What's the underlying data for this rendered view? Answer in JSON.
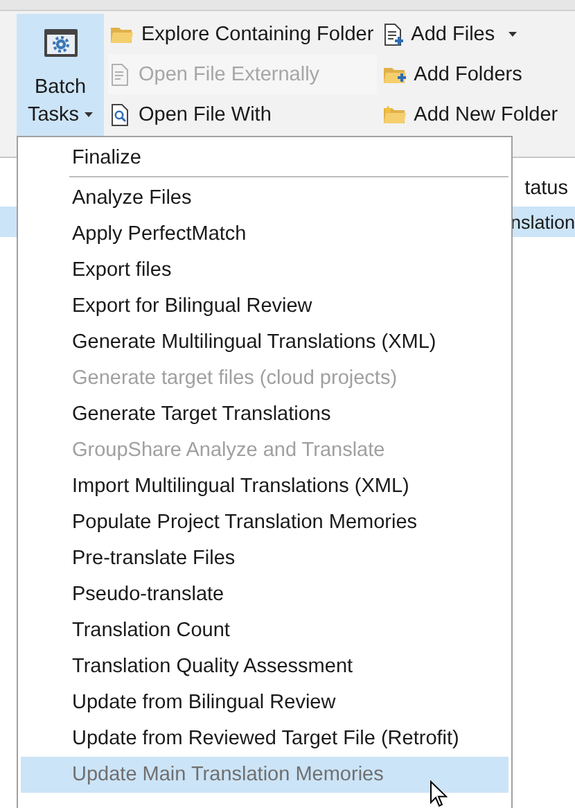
{
  "ribbon": {
    "batch_button": {
      "label": "Batch Tasks",
      "dropdown": true,
      "selected": true
    },
    "columns": [
      [
        {
          "label": "Explore Containing Folder",
          "disabled": false,
          "dropdown": false
        },
        {
          "label": "Open File Externally",
          "disabled": true,
          "dropdown": false
        },
        {
          "label": "Open File With",
          "disabled": false,
          "dropdown": false
        }
      ],
      [
        {
          "label": "Add Files",
          "disabled": false,
          "dropdown": true
        },
        {
          "label": "Add Folders",
          "disabled": false,
          "dropdown": false
        },
        {
          "label": "Add New Folder",
          "disabled": false,
          "dropdown": false
        }
      ]
    ]
  },
  "table": {
    "header": "tatus",
    "row": {
      "cell": "nslation",
      "selected": true
    }
  },
  "menu": {
    "groups": [
      [
        {
          "label": "Finalize",
          "disabled": false,
          "selected": false
        }
      ],
      [
        {
          "label": "Analyze Files",
          "disabled": false,
          "selected": false
        },
        {
          "label": "Apply PerfectMatch",
          "disabled": false,
          "selected": false
        },
        {
          "label": "Export files",
          "disabled": false,
          "selected": false
        },
        {
          "label": "Export for Bilingual Review",
          "disabled": false,
          "selected": false
        },
        {
          "label": "Generate Multilingual Translations (XML)",
          "disabled": false,
          "selected": false
        },
        {
          "label": "Generate target files (cloud projects)",
          "disabled": true,
          "selected": false
        },
        {
          "label": "Generate Target Translations",
          "disabled": false,
          "selected": false
        },
        {
          "label": "GroupShare Analyze and Translate",
          "disabled": true,
          "selected": false
        },
        {
          "label": "Import Multilingual Translations (XML)",
          "disabled": false,
          "selected": false
        },
        {
          "label": "Populate Project Translation Memories",
          "disabled": false,
          "selected": false
        },
        {
          "label": "Pre-translate Files",
          "disabled": false,
          "selected": false
        },
        {
          "label": "Pseudo-translate",
          "disabled": false,
          "selected": false
        },
        {
          "label": "Translation Count",
          "disabled": false,
          "selected": false
        },
        {
          "label": "Translation Quality Assessment",
          "disabled": false,
          "selected": false
        },
        {
          "label": "Update from Bilingual Review",
          "disabled": false,
          "selected": false
        },
        {
          "label": "Update from Reviewed Target File (Retrofit)",
          "disabled": false,
          "selected": false
        },
        {
          "label": "Update Main Translation Memories",
          "disabled": true,
          "selected": true
        }
      ]
    ]
  }
}
